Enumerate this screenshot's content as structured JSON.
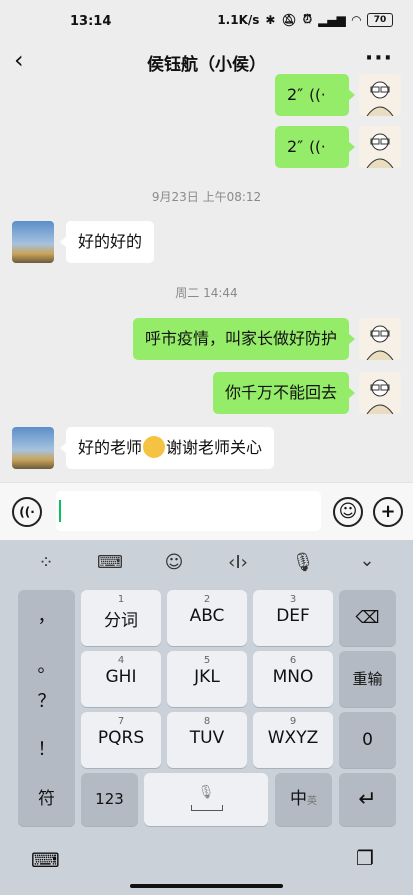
{
  "status_bar": {
    "time": "13:14",
    "net_speed": "1.1K/s",
    "battery": "70"
  },
  "header": {
    "title": "侯钰航（小侯）",
    "back_icon": "chevron-left-icon",
    "more_icon": "more-dots-icon"
  },
  "messages": [
    {
      "side": "me",
      "type": "voice",
      "text": "2″"
    },
    {
      "side": "me",
      "type": "voice",
      "text": "2″"
    },
    {
      "type": "time",
      "text": "9月23日 上午08:12"
    },
    {
      "side": "them",
      "type": "text",
      "text": "好的好的"
    },
    {
      "type": "time",
      "text": "周二 14:44"
    },
    {
      "side": "me",
      "type": "text",
      "text": "呼市疫情，叫家长做好防护"
    },
    {
      "side": "me",
      "type": "text",
      "text": "你千万不能回去"
    },
    {
      "side": "them",
      "type": "text",
      "before_emoji": "好的老师",
      "after_emoji": "谢谢老师关心",
      "emoji": "thinking-face"
    }
  ],
  "input": {
    "value": ""
  },
  "keyboard": {
    "toolbar": [
      "apps-grid-icon",
      "keyboard-icon",
      "emoji-icon",
      "cursor-icon",
      "mic-icon",
      "collapse-icon"
    ],
    "symbols": [
      "，",
      "。",
      "？",
      "！"
    ],
    "rows": [
      [
        {
          "num": "1",
          "label": "分词"
        },
        {
          "num": "2",
          "label": "ABC"
        },
        {
          "num": "3",
          "label": "DEF"
        }
      ],
      [
        {
          "num": "4",
          "label": "GHI"
        },
        {
          "num": "5",
          "label": "JKL"
        },
        {
          "num": "6",
          "label": "MNO"
        }
      ],
      [
        {
          "num": "7",
          "label": "PQRS"
        },
        {
          "num": "8",
          "label": "TUV"
        },
        {
          "num": "9",
          "label": "WXYZ"
        }
      ]
    ],
    "right_keys": {
      "delete": "⌫",
      "reenter": "重输",
      "zero": "0",
      "enter": "↵"
    },
    "bottom": {
      "symbol": "符",
      "numbers": "123",
      "lang": "中",
      "lang_sub": "英"
    }
  }
}
